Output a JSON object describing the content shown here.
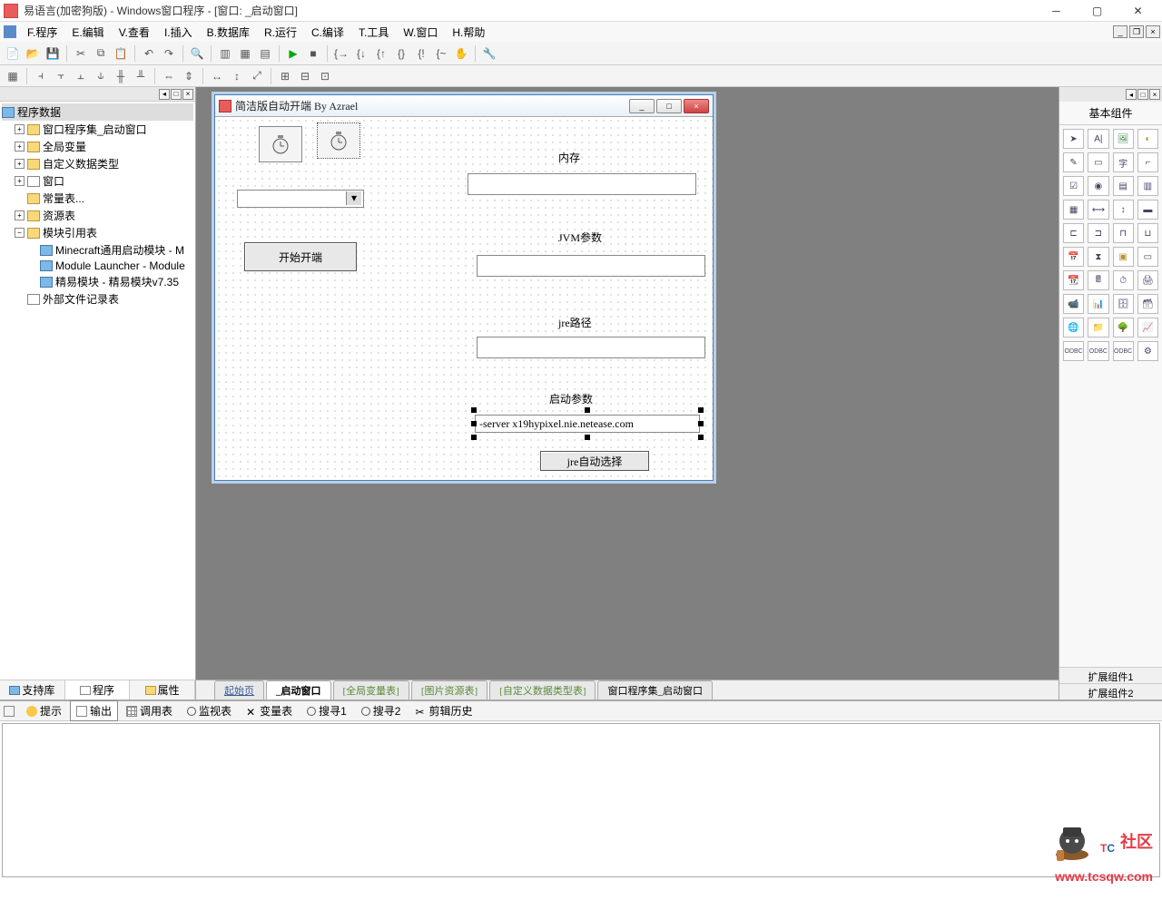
{
  "window": {
    "title": "易语言(加密狗版) - Windows窗口程序 - [窗口: _启动窗口]"
  },
  "menu": {
    "items": [
      "F.程序",
      "E.编辑",
      "V.查看",
      "I.插入",
      "B.数据库",
      "R.运行",
      "C.编译",
      "T.工具",
      "W.窗口",
      "H.帮助"
    ]
  },
  "tree": {
    "root": "程序数据",
    "n1": "窗口程序集_启动窗口",
    "n2": "全局变量",
    "n3": "自定义数据类型",
    "n4": "窗口",
    "n5": "常量表...",
    "n6": "资源表",
    "n7": "模块引用表",
    "n7a": "Minecraft通用启动模块 - M",
    "n7b": "Module Launcher - Module",
    "n7c": "精易模块 - 精易模块v7.35",
    "n8": "外部文件记录表"
  },
  "left_tabs": {
    "t1": "支持库",
    "t2": "程序",
    "t3": "属性"
  },
  "form": {
    "title": "简洁版自动开端 By Azrael",
    "btn_start": "开始开端",
    "lbl_mem": "内存",
    "lbl_jvm": "JVM参数",
    "lbl_jre": "jre路径",
    "lbl_launch": "启动参数",
    "txt_launch": "-server x19hypixel.nie.netease.com",
    "btn_jre": "jre自动选择"
  },
  "center_tabs": {
    "t1": "起始页",
    "t2": "_启动窗口",
    "t3": "[全局变量表]",
    "t4": "[图片资源表]",
    "t5": "[自定义数据类型表]",
    "t6": "窗口程序集_启动窗口"
  },
  "right": {
    "title": "基本组件",
    "foot1": "扩展组件1",
    "foot2": "扩展组件2"
  },
  "bottom_tabs": {
    "t1": "提示",
    "t2": "输出",
    "t3": "调用表",
    "t4": "监视表",
    "t5": "变量表",
    "t6": "搜寻1",
    "t7": "搜寻2",
    "t8": "剪辑历史"
  },
  "watermark": {
    "sub": "社区",
    "url": "www.tcsqw.com"
  }
}
